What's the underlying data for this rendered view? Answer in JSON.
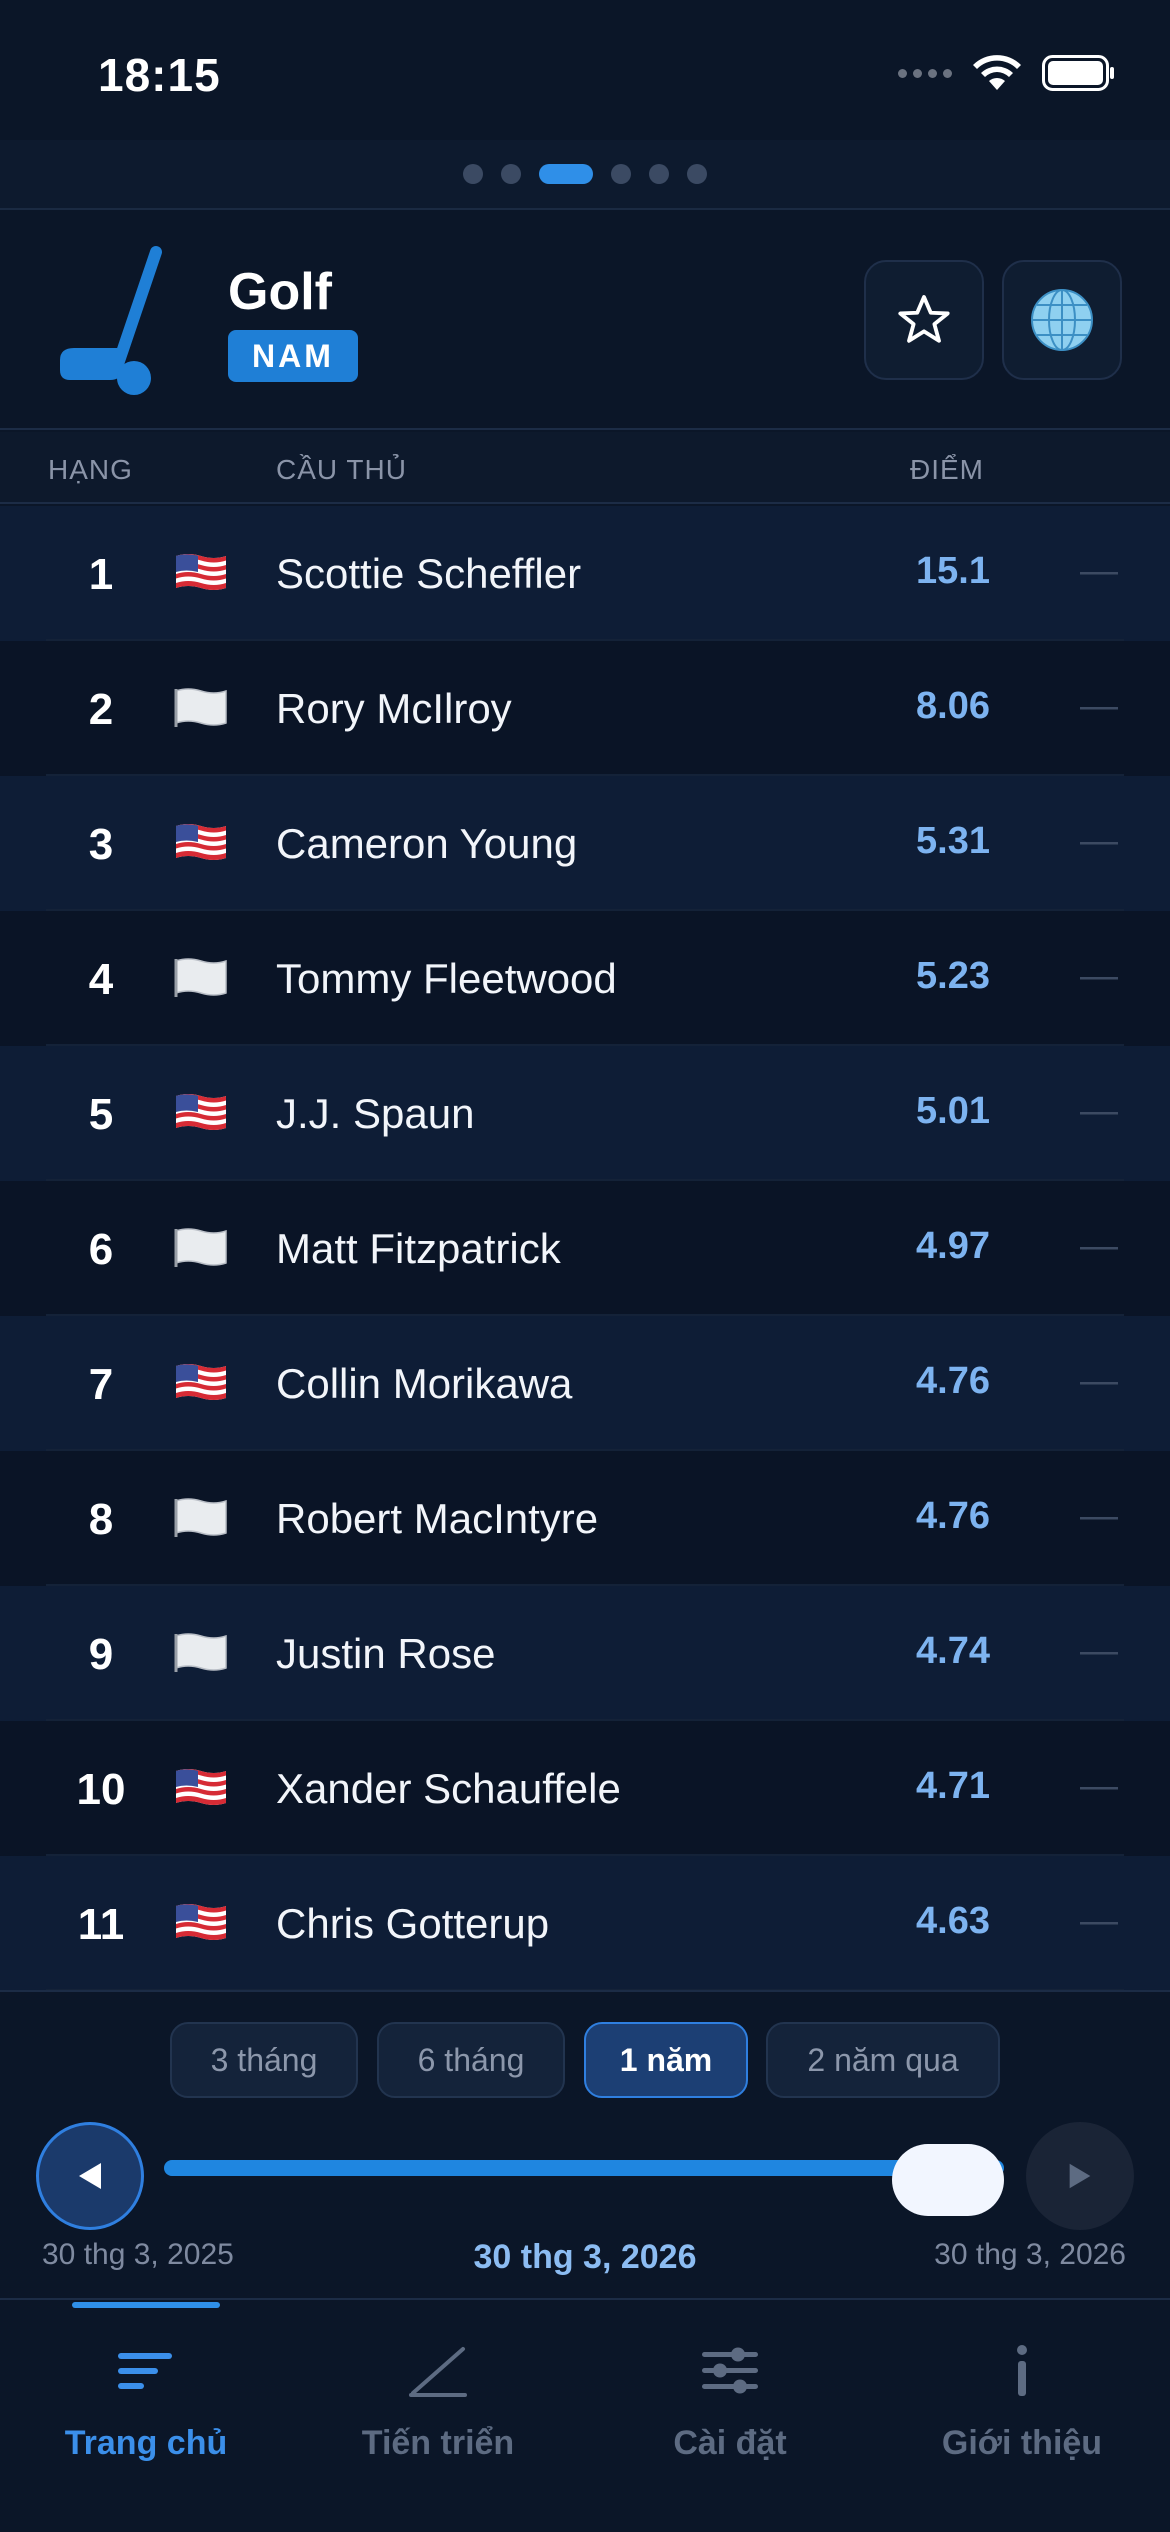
{
  "status": {
    "time": "18:15"
  },
  "header": {
    "title": "Golf",
    "badge": "NAM"
  },
  "columns": {
    "rank": "HẠNG",
    "player": "CẦU THỦ",
    "points": "ĐIỂM"
  },
  "rows": [
    {
      "rank": "1",
      "flag": "us-flag",
      "name": "Scottie Scheffler",
      "score": "15.1",
      "change": "—"
    },
    {
      "rank": "2",
      "flag": "white-flag",
      "name": "Rory McIlroy",
      "score": "8.06",
      "change": "—"
    },
    {
      "rank": "3",
      "flag": "us-flag",
      "name": "Cameron Young",
      "score": "5.31",
      "change": "—"
    },
    {
      "rank": "4",
      "flag": "white-flag",
      "name": "Tommy Fleetwood",
      "score": "5.23",
      "change": "—"
    },
    {
      "rank": "5",
      "flag": "us-flag",
      "name": "J.J. Spaun",
      "score": "5.01",
      "change": "—"
    },
    {
      "rank": "6",
      "flag": "white-flag",
      "name": "Matt Fitzpatrick",
      "score": "4.97",
      "change": "—"
    },
    {
      "rank": "7",
      "flag": "us-flag",
      "name": "Collin Morikawa",
      "score": "4.76",
      "change": "—"
    },
    {
      "rank": "8",
      "flag": "white-flag",
      "name": "Robert MacIntyre",
      "score": "4.76",
      "change": "—"
    },
    {
      "rank": "9",
      "flag": "white-flag",
      "name": "Justin Rose",
      "score": "4.74",
      "change": "—"
    },
    {
      "rank": "10",
      "flag": "us-flag",
      "name": "Xander Schauffele",
      "score": "4.71",
      "change": "—"
    },
    {
      "rank": "11",
      "flag": "us-flag",
      "name": "Chris Gotterup",
      "score": "4.63",
      "change": "—"
    }
  ],
  "ranges": [
    {
      "label": "3 tháng",
      "active": false
    },
    {
      "label": "6 tháng",
      "active": false
    },
    {
      "label": "1 năm",
      "active": true
    },
    {
      "label": "2 năm qua",
      "active": false
    }
  ],
  "timeline": {
    "start": "30 thg 3, 2025",
    "current": "30 thg 3, 2026",
    "end": "30 thg 3, 2026",
    "position": 1.0
  },
  "tabs": [
    {
      "label": "Trang chủ",
      "icon": "list-icon",
      "active": true
    },
    {
      "label": "Tiến triển",
      "icon": "trend-icon",
      "active": false
    },
    {
      "label": "Cài đặt",
      "icon": "sliders-icon",
      "active": false
    },
    {
      "label": "Giới thiệu",
      "icon": "info-icon",
      "active": false
    }
  ],
  "colors": {
    "accent": "#2f8fe8",
    "background": "#0b1628",
    "score": "#7db3f0"
  }
}
